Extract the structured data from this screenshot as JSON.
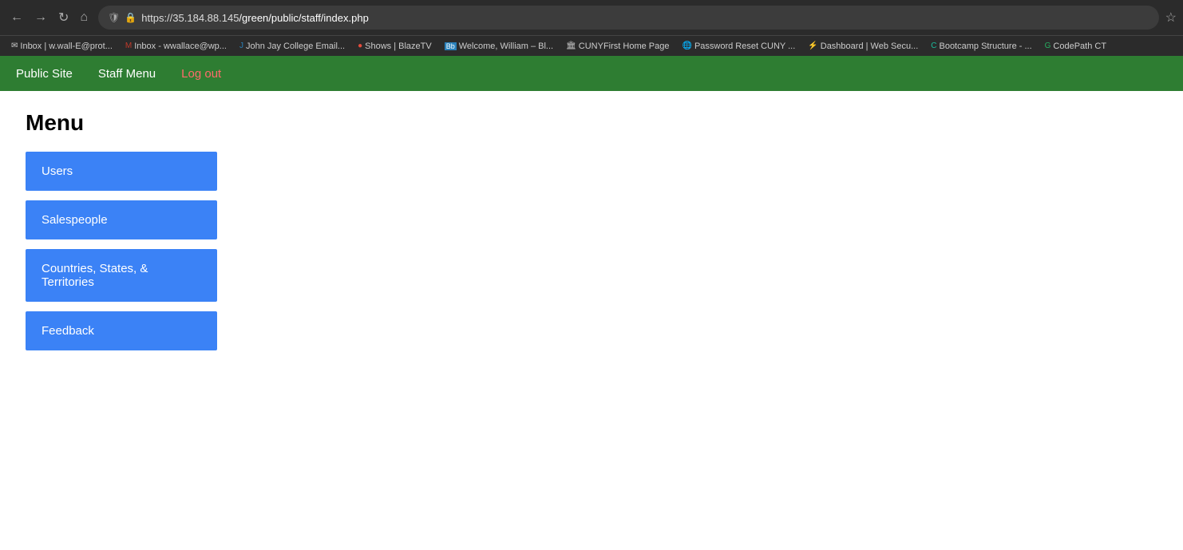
{
  "browser": {
    "url_prefix": "https://35.184.88.145",
    "url_path": "/green/public/staff/index.php",
    "bookmarks": [
      {
        "label": "Inbox | w.wall-E@prot...",
        "icon": "✉"
      },
      {
        "label": "Inbox - wwallace@wp...",
        "icon": "M"
      },
      {
        "label": "John Jay College Email...",
        "icon": "J"
      },
      {
        "label": "Shows | BlazeTV",
        "icon": "●"
      },
      {
        "label": "Welcome, William – Bl...",
        "icon": "B"
      },
      {
        "label": "CUNYFirst Home Page",
        "icon": "🏛"
      },
      {
        "label": "Password Reset CUNY ...",
        "icon": "🌐"
      },
      {
        "label": "Dashboard | Web Secu...",
        "icon": "⚡"
      },
      {
        "label": "Bootcamp Structure - ...",
        "icon": "C"
      },
      {
        "label": "CodePath CT",
        "icon": "G"
      }
    ]
  },
  "nav": {
    "public_site_label": "Public Site",
    "staff_menu_label": "Staff Menu",
    "logout_label": "Log out"
  },
  "page": {
    "title": "Menu",
    "menu_items": [
      {
        "label": "Users"
      },
      {
        "label": "Salespeople"
      },
      {
        "label": "Countries, States, & Territories"
      },
      {
        "label": "Feedback"
      }
    ]
  }
}
